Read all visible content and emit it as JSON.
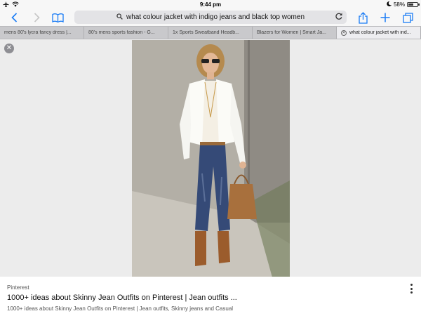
{
  "status_bar": {
    "time": "9:44 pm",
    "battery_text": "58%",
    "battery_level": 0.58,
    "icons": [
      "airplane-icon",
      "wifi-icon",
      "moon-icon",
      "battery-icon"
    ]
  },
  "toolbar": {
    "address_text": "what colour jacket with indigo jeans and black top women",
    "accent_color": "#1a7cf5",
    "icons": [
      "back-icon",
      "forward-icon",
      "bookmarks-icon",
      "search-icon",
      "reload-icon",
      "share-icon",
      "new-tab-icon",
      "tabs-icon"
    ]
  },
  "tabs": [
    {
      "label": "mens 80's lycra fancy dress |...",
      "active": false
    },
    {
      "label": "80's mens sports fashion - G...",
      "active": false
    },
    {
      "label": "1x Sports Sweatband Headb...",
      "active": false
    },
    {
      "label": "Blazers for Women | Smart Ja...",
      "active": false
    },
    {
      "label": "what colour jacket with ind...",
      "active": true
    }
  ],
  "content": {
    "image_alt_icon": "close-icon"
  },
  "result": {
    "source": "Pinterest",
    "title": "1000+ ideas about Skinny Jean Outfits on Pinterest | Jean outfits ...",
    "description": "1000+ ideas about Skinny Jean Outfits on Pinterest | Jean outfits, Skinny jeans and Casual"
  }
}
